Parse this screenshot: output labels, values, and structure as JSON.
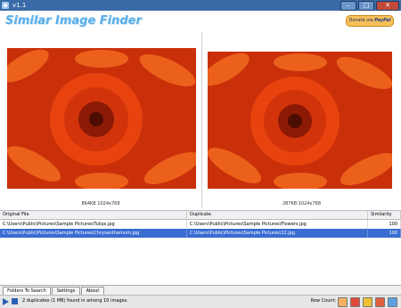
{
  "window": {
    "title": "v1.1"
  },
  "header": {
    "app_name": "Similar Image Finder",
    "donate_label": "Donate via",
    "donate_brand": "PayPal"
  },
  "left_preview": {
    "info": "864KB 1024x768"
  },
  "right_preview": {
    "info": "287KB 1024x768"
  },
  "table": {
    "columns": [
      "Original File",
      "Duplicate",
      "Similarity"
    ],
    "rows": [
      {
        "original": "C:\\Users\\Public\\Pictures\\Sample Pictures\\Tulips.jpg",
        "duplicate": "C:\\Users\\Public\\Pictures\\Sample Pictures\\Flowers.jpg",
        "similarity": "100"
      },
      {
        "original": "C:\\Users\\Public\\Pictures\\Sample Pictures\\Chrysanthemum.jpg",
        "duplicate": "C:\\Users\\Public\\Pictures\\Sample Pictures\\12.jpg",
        "similarity": "100"
      }
    ]
  },
  "tabs": [
    "Folders To Search",
    "Settings",
    "About"
  ],
  "status": {
    "message": "2 duplicates (1 MB) found in  among 10 images.",
    "row_count": "Row Count: 2"
  },
  "colors": {
    "title_bar": "#3a6aa8",
    "selection": "#3a6dd2",
    "logo": "#5aaee8",
    "flower": "#e8420e"
  }
}
